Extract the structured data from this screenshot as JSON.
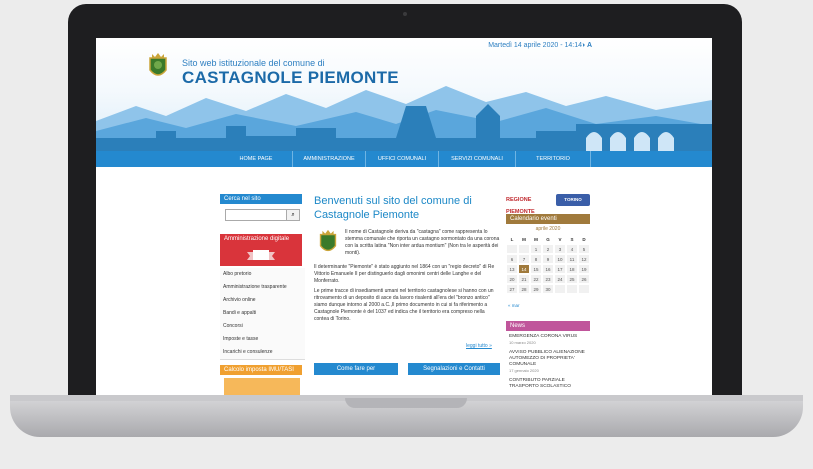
{
  "header": {
    "date": "Martedì 14 aprile 2020 - 14:14",
    "contrast_icons": "◑ A",
    "site_subtitle": "Sito web istituzionale del comune di",
    "site_name": "CASTAGNOLE PIEMONTE"
  },
  "nav": [
    "HOME PAGE",
    "AMMINISTRAZIONE",
    "UFFICI COMUNALI",
    "SERVIZI COMUNALI",
    "TERRITORIO"
  ],
  "left": {
    "search_title": "Cerca nel sito",
    "search_icon": "search-icon",
    "admin_title": "Amministrazione digitale",
    "links": [
      "Albo pretorio",
      "Amministrazione trasparente",
      "Archivio online",
      "Bandi e appalti",
      "Concorsi",
      "Imposte e tasse",
      "Incarichi e consulenze"
    ],
    "calc_title": "Calcolo imposta IMU/TASI"
  },
  "main": {
    "title": "Benvenuti sul sito del comune di Castagnole Piemonte",
    "intro": "Il nome di Castagnole deriva da \"castagna\" come rappresenta lo stemma comunale che riporta un castagno sormontato da una corona con la scritta latina \"Non inter ardua montium\" (Non tra le asperità dei monti).",
    "p1": "Il determinante \"Piemonte\" è stato aggiunto nel 1864 con un \"regio decreto\" di Re Vittorio Emanuele II per distinguerlo dagli omonimi centri delle Langhe e del Monferrato.",
    "p2": "Le prime tracce di insediamenti umani nel territorio castagnolese si hanno con un ritrovamento di un deposito di asce da lavoro risalenti all'era del \"bronzo antico\" siamo dunque intorno al 2000 a.C.,Il primo documento in cui si fa riferimento a Castagnole Piemonte è del 1037 ed indica che il territorio era compreso nella contea di Torino.",
    "read_more": "leggi tutto »",
    "btn_how": "Come fare per",
    "btn_report": "Segnalazioni e Contatti"
  },
  "right": {
    "brand1": "REGIONE PIEMONTE",
    "brand2": "TORINO METROPOLI",
    "calendar_title": "Calendario eventi",
    "month": "aprile 2020",
    "days": [
      "L",
      "M",
      "M",
      "G",
      "V",
      "S",
      "D"
    ],
    "weeks": [
      [
        "",
        "",
        "1",
        "2",
        "3",
        "4",
        "5"
      ],
      [
        "6",
        "7",
        "8",
        "9",
        "10",
        "11",
        "12"
      ],
      [
        "13",
        "14",
        "15",
        "16",
        "17",
        "18",
        "19"
      ],
      [
        "20",
        "21",
        "22",
        "23",
        "24",
        "25",
        "26"
      ],
      [
        "27",
        "28",
        "29",
        "30",
        "",
        "",
        ""
      ]
    ],
    "prev": "« mar",
    "news_title": "News",
    "news": [
      {
        "title": "EMERGENZA CORONA VIRUS",
        "date": "10 marzo 2020"
      },
      {
        "title": "AVVISO PUBBLICO ALIENAZIONE AUTOMEZZO DI PROPRIETA' COMUNALE",
        "date": "17 gennaio 2020"
      },
      {
        "title": "CONTRIBUTO PARZIALE TRASPORTO SCOLASTICO",
        "date": ""
      }
    ]
  },
  "colors": {
    "accent": "#2489cf",
    "calendar": "#a07a3c",
    "news": "#c0559b",
    "admin": "#d9343b",
    "calc": "#f0a030"
  }
}
